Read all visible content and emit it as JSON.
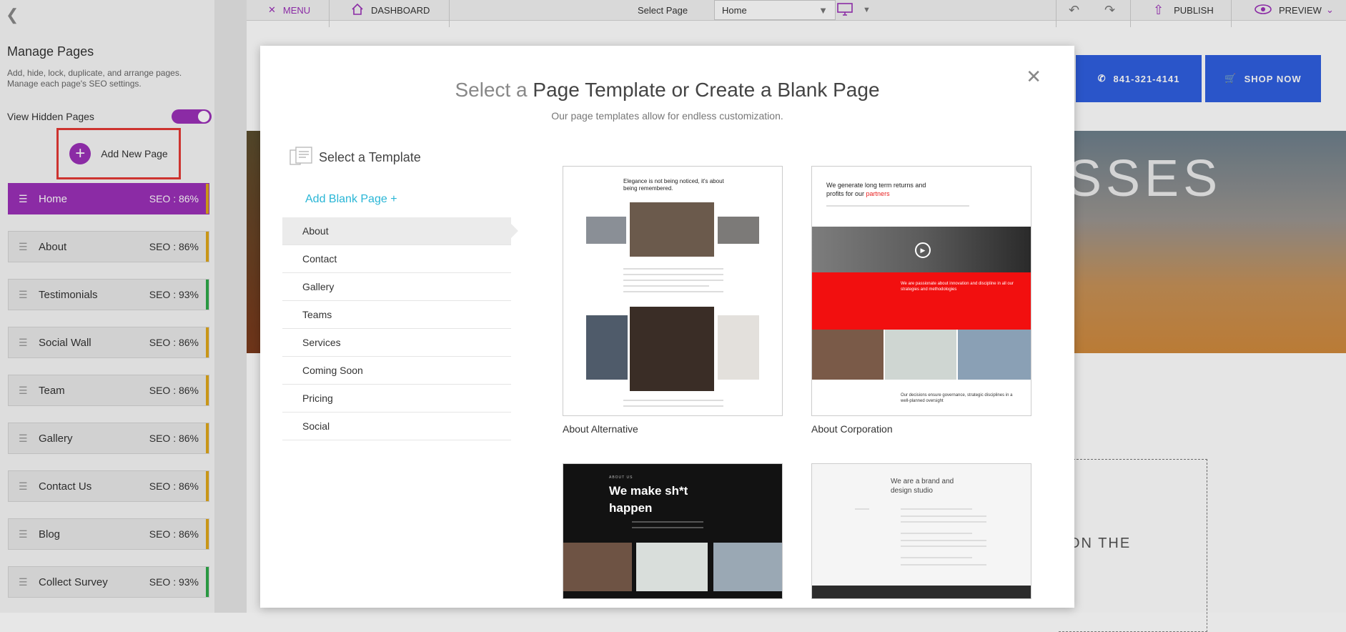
{
  "toolbar": {
    "menu_label": "MENU",
    "dashboard_label": "DASHBOARD",
    "select_page_label": "Select Page",
    "select_page_value": "Home",
    "publish_label": "PUBLISH",
    "preview_label": "PREVIEW"
  },
  "left_panel": {
    "title": "Manage Pages",
    "description": "Add, hide, lock, duplicate, and arrange pages. Manage each page's SEO settings.",
    "view_hidden_label": "View Hidden Pages",
    "add_new_page_label": "Add New Page",
    "pages": [
      {
        "name": "Home",
        "seo": "SEO : 86%",
        "bar": "#e0a81a",
        "active": true
      },
      {
        "name": "About",
        "seo": "SEO : 86%",
        "bar": "#e0a81a"
      },
      {
        "name": "Testimonials",
        "seo": "SEO : 93%",
        "bar": "#2eaa4a"
      },
      {
        "name": "Social Wall",
        "seo": "SEO : 86%",
        "bar": "#e0a81a"
      },
      {
        "name": "Team",
        "seo": "SEO : 86%",
        "bar": "#e0a81a"
      },
      {
        "name": "Gallery",
        "seo": "SEO : 86%",
        "bar": "#e0a81a"
      },
      {
        "name": "Contact Us",
        "seo": "SEO : 86%",
        "bar": "#e0a81a"
      },
      {
        "name": "Blog",
        "seo": "SEO : 86%",
        "bar": "#e0a81a"
      },
      {
        "name": "Collect Survey",
        "seo": "SEO : 93%",
        "bar": "#2eaa4a"
      }
    ]
  },
  "site": {
    "phone": "841-321-4141",
    "shop_label": "SHOP NOW",
    "hero_text": "SSES",
    "body_text": "ON THE"
  },
  "modal": {
    "title_light": "Select a",
    "title_strong": "Page Template or Create a Blank Page",
    "subtitle": "Our page templates allow for endless customization.",
    "select_template_label": "Select a Template",
    "add_blank_label": "Add Blank Page +",
    "categories": [
      "About",
      "Contact",
      "Gallery",
      "Teams",
      "Services",
      "Coming Soon",
      "Pricing",
      "Social"
    ],
    "templates": [
      {
        "name": "About Alternative",
        "headline": "Elegance is not being noticed, it's about being remembered."
      },
      {
        "name": "About Corporation",
        "headline_a": "We generate long term returns and profits for our",
        "headline_b": "partners",
        "red_text": "We are passionate about innovation and discipline in all our strategies and methodologies",
        "lower_text": "Our decisions ensure governance, strategic disciplines in a well-planned oversight"
      },
      {
        "name": "",
        "kicker": "ABOUT US",
        "headline": "We make sh*t happen"
      },
      {
        "name": "",
        "headline": "We are a brand and design studio"
      }
    ]
  }
}
